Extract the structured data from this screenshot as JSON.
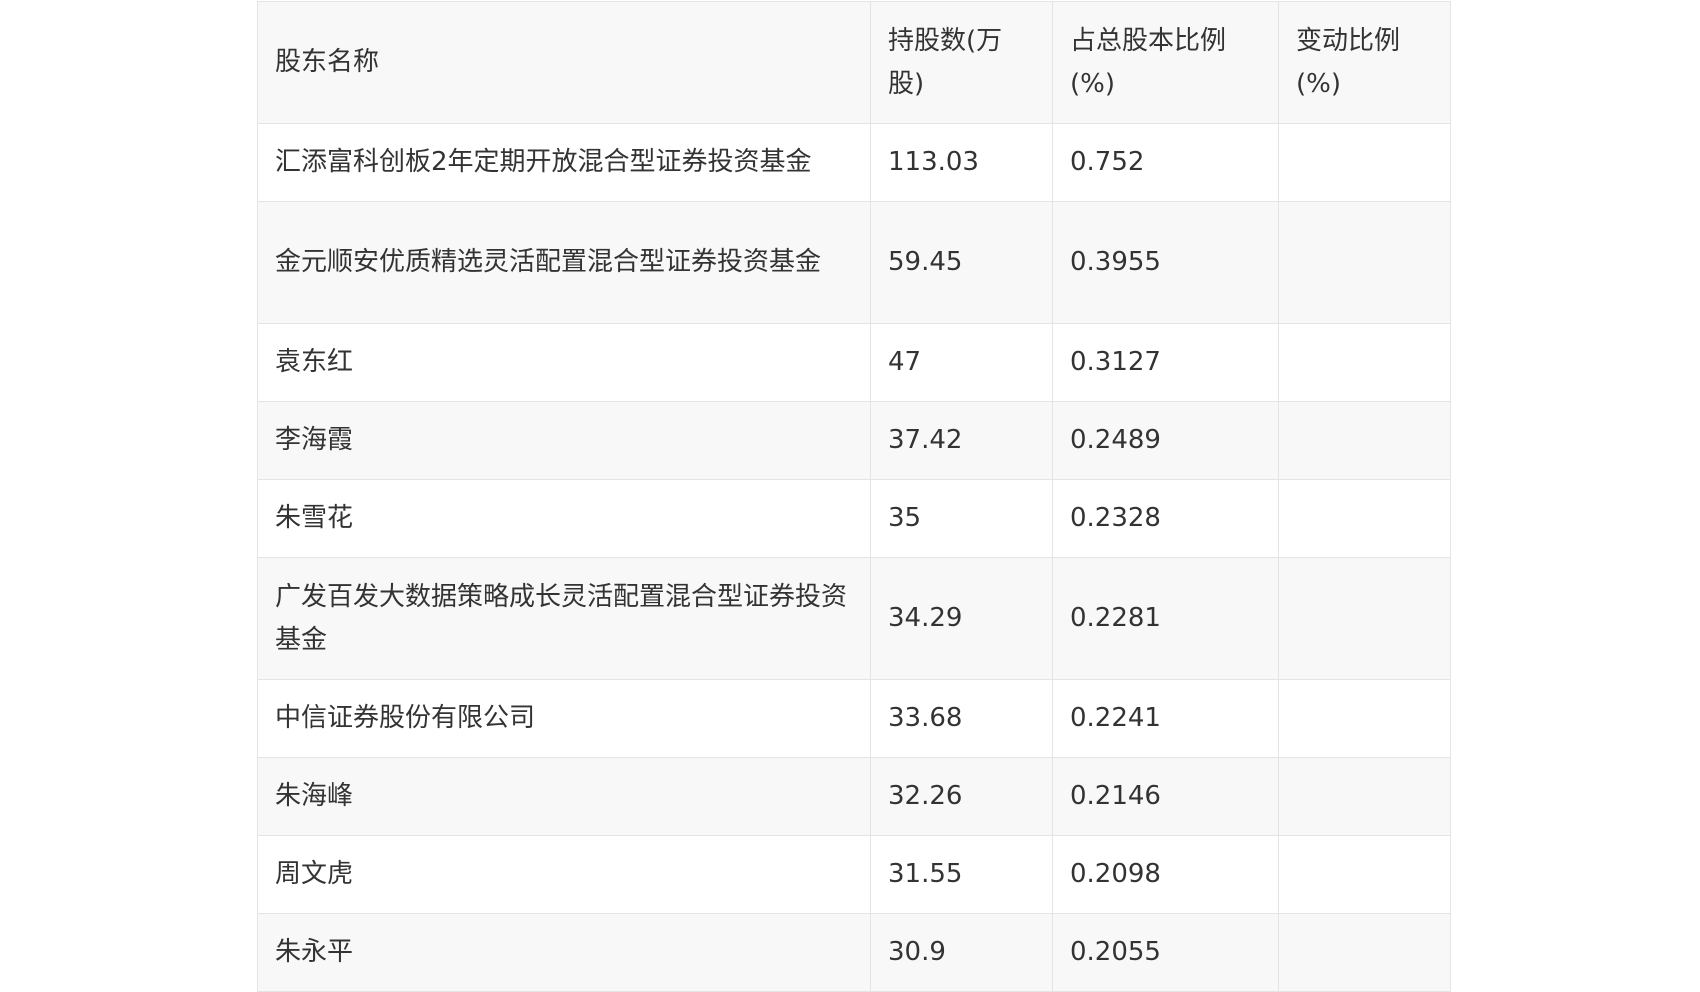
{
  "table": {
    "headers": [
      "股东名称",
      "持股数(万股)",
      "占总股本比例(%)",
      "变动比例(%)"
    ],
    "rows": [
      {
        "name": "汇添富科创板2年定期开放混合型证券投资基金",
        "shares": "113.03",
        "ratio": "0.752",
        "change": ""
      },
      {
        "name": "金元顺安优质精选灵活配置混合型证券投资基金",
        "shares": "59.45",
        "ratio": "0.3955",
        "change": ""
      },
      {
        "name": "袁东红",
        "shares": "47",
        "ratio": "0.3127",
        "change": ""
      },
      {
        "name": "李海霞",
        "shares": "37.42",
        "ratio": "0.2489",
        "change": ""
      },
      {
        "name": "朱雪花",
        "shares": "35",
        "ratio": "0.2328",
        "change": ""
      },
      {
        "name": "广发百发大数据策略成长灵活配置混合型证券投资基金",
        "shares": "34.29",
        "ratio": "0.2281",
        "change": ""
      },
      {
        "name": "中信证券股份有限公司",
        "shares": "33.68",
        "ratio": "0.2241",
        "change": ""
      },
      {
        "name": "朱海峰",
        "shares": "32.26",
        "ratio": "0.2146",
        "change": ""
      },
      {
        "name": "周文虎",
        "shares": "31.55",
        "ratio": "0.2098",
        "change": ""
      },
      {
        "name": "朱永平",
        "shares": "30.9",
        "ratio": "0.2055",
        "change": ""
      }
    ]
  }
}
